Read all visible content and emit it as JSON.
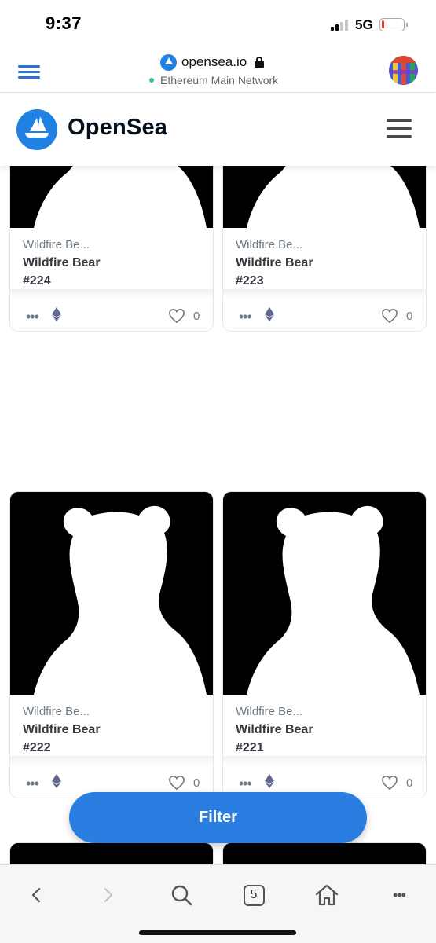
{
  "status_bar": {
    "time": "9:37",
    "network": "5G",
    "battery_level": 0.12,
    "battery_color": "#e33a2f"
  },
  "browser": {
    "url": "opensea.io",
    "network_status": "Ethereum Main Network",
    "icons": [
      "menu-icon",
      "site-logo-icon",
      "lock-icon",
      "avatar"
    ]
  },
  "header": {
    "brand": "OpenSea",
    "brand_color": "#2081e2"
  },
  "cards": [
    {
      "collection": "Wildfire Be...",
      "name": "Wildfire Bear",
      "number": "#224",
      "likes": "0"
    },
    {
      "collection": "Wildfire Be...",
      "name": "Wildfire Bear",
      "number": "#223",
      "likes": "0"
    },
    {
      "collection": "Wildfire Be...",
      "name": "Wildfire Bear",
      "number": "#222",
      "likes": "0"
    },
    {
      "collection": "Wildfire Be...",
      "name": "Wildfire Bear",
      "number": "#221",
      "likes": "0"
    }
  ],
  "filter_button": {
    "label": "Filter",
    "color": "#2a7de1"
  },
  "toolbar": {
    "tabs_count": "5",
    "icons": [
      "back-icon",
      "forward-icon",
      "search-icon",
      "tabs-icon",
      "home-icon",
      "more-icon"
    ]
  }
}
